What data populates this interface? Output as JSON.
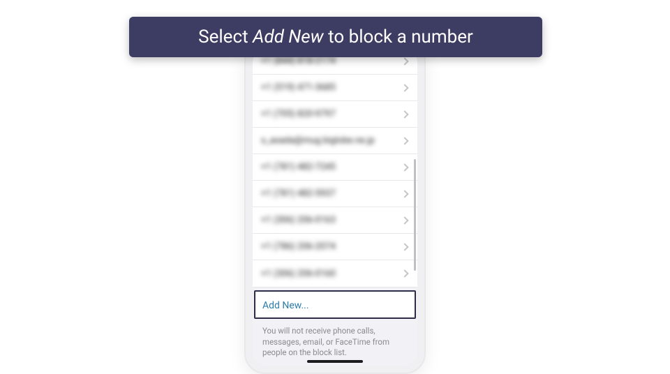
{
  "banner": {
    "prefix": "Select ",
    "emph": "Add New",
    "suffix": " to block a number"
  },
  "blocked_list": {
    "items": [
      {
        "label": "+1 (844) 818-2174"
      },
      {
        "label": "+1 (519) 471-3685"
      },
      {
        "label": "+1 (705) 820-9797"
      },
      {
        "label": "s_asada@mug.biglobe.ne.jp"
      },
      {
        "label": "+1 (781) 482-7245"
      },
      {
        "label": "+1 (781) 482-5937"
      },
      {
        "label": "+1 (306) 206-0163"
      },
      {
        "label": "+1 (786) 206-2074"
      },
      {
        "label": "+1 (306) 206-0160"
      }
    ],
    "add_new_label": "Add New...",
    "footer": "You will not receive phone calls, messages, email, or FaceTime from people on the block list."
  }
}
